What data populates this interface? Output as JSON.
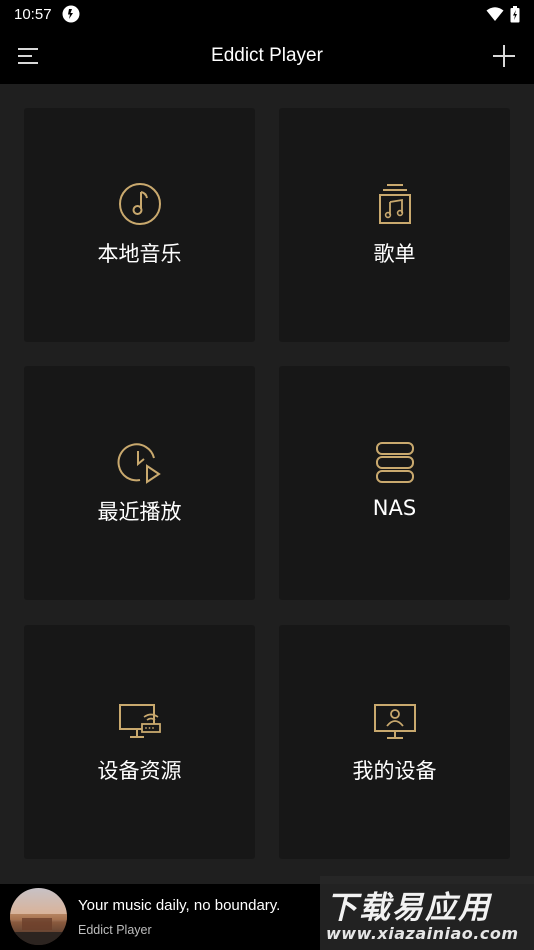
{
  "status_bar": {
    "time": "10:57"
  },
  "app_bar": {
    "title": "Eddict Player"
  },
  "tiles": [
    {
      "label": "本地音乐",
      "icon": "music-note-circle-icon"
    },
    {
      "label": "歌单",
      "icon": "playlist-icon"
    },
    {
      "label": "最近播放",
      "icon": "recent-play-icon"
    },
    {
      "label": "NAS",
      "icon": "nas-server-icon"
    },
    {
      "label": "设备资源",
      "icon": "device-resource-icon"
    },
    {
      "label": "我的设备",
      "icon": "my-device-icon"
    }
  ],
  "player": {
    "title": "Your music daily, no boundary.",
    "subtitle": "Eddict Player"
  },
  "watermark": {
    "line1": "下载易应用",
    "line2": "www.xiazainiao.com"
  },
  "colors": {
    "accent_gold": "#c9a96e",
    "background": "#1f1f1f",
    "tile": "#171717"
  }
}
